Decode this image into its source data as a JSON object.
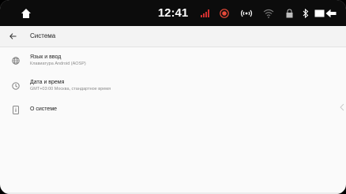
{
  "statusbar": {
    "time": "12:41",
    "icons": [
      "home-icon",
      "signal-off-icon",
      "record-icon",
      "radio-icon",
      "wifi-icon",
      "lock-icon",
      "bluetooth-icon",
      "window-icon",
      "back-icon"
    ],
    "colors": {
      "background": "#0c0c0c",
      "signal": "#d03030",
      "record": "#e84a3a"
    }
  },
  "appbar": {
    "title": "Система",
    "icon": "back-arrow-icon"
  },
  "settings": {
    "items": [
      {
        "icon": "globe-icon",
        "title": "Язык и ввод",
        "subtitle": "Клавиатура Android (AOSP)"
      },
      {
        "icon": "clock-icon",
        "title": "Дата и время",
        "subtitle": "GMT+03:00 Москва, стандартное время"
      },
      {
        "icon": "phone-info-icon",
        "title": "О системе",
        "subtitle": ""
      }
    ]
  }
}
